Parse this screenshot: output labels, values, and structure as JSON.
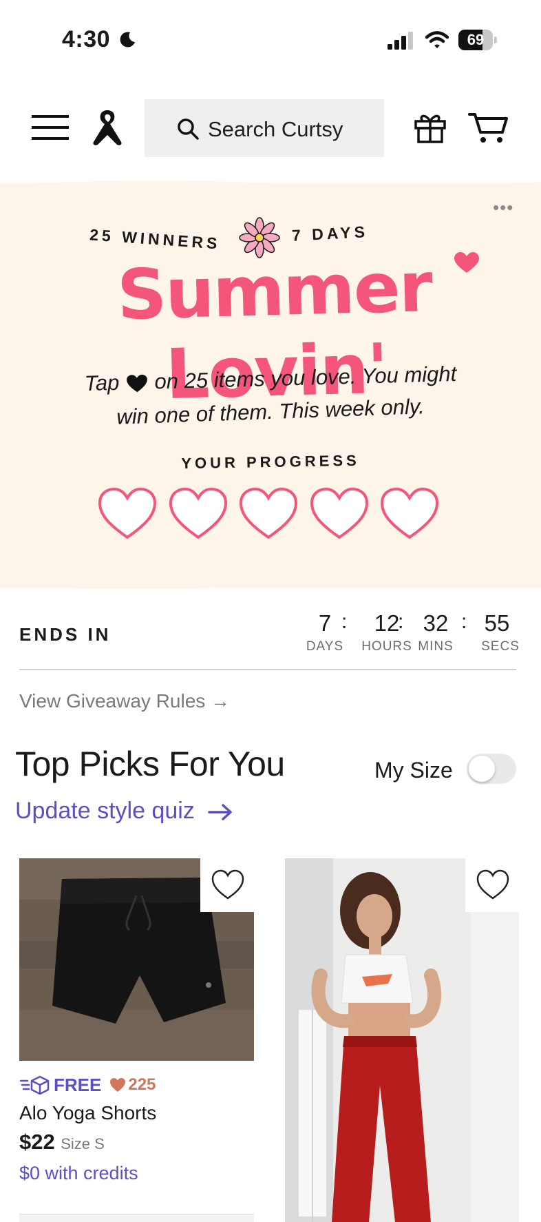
{
  "status_bar": {
    "time": "4:30",
    "battery": "69",
    "battery_level": 0.69
  },
  "header": {
    "search_placeholder": "Search Curtsy"
  },
  "banner": {
    "winners": "25 WINNERS",
    "days": "7 DAYS",
    "title": "Summer Lovin'",
    "line1_before": "Tap",
    "line1_after": "on 25 items you love.  You might",
    "line2": "win one of them. This week only.",
    "progress_label": "YOUR PROGRESS",
    "progress_filled": 0,
    "progress_total": 5,
    "accent_color": "#f4557a",
    "background_color": "#fdf4ea"
  },
  "countdown": {
    "label": "ENDS IN",
    "days": "7",
    "hours": "12",
    "mins": "32",
    "secs": "55",
    "days_label": "DAYS",
    "hours_label": "HOURS",
    "mins_label": "MINS",
    "secs_label": "SECS"
  },
  "rules_link": "View Giveaway Rules →",
  "picks": {
    "title": "Top Picks For You",
    "my_size_label": "My Size",
    "my_size_on": false,
    "quiz_link": "Update style quiz",
    "link_color": "#5a4fc4"
  },
  "products": [
    {
      "shipping": "FREE",
      "likes": "225",
      "name": "Alo Yoga Shorts",
      "price": "$22",
      "size": "Size S",
      "credits": "$0 with credits",
      "image": "black-athletic-shorts"
    },
    {
      "image": "model-white-crop-top-red-pants"
    }
  ]
}
